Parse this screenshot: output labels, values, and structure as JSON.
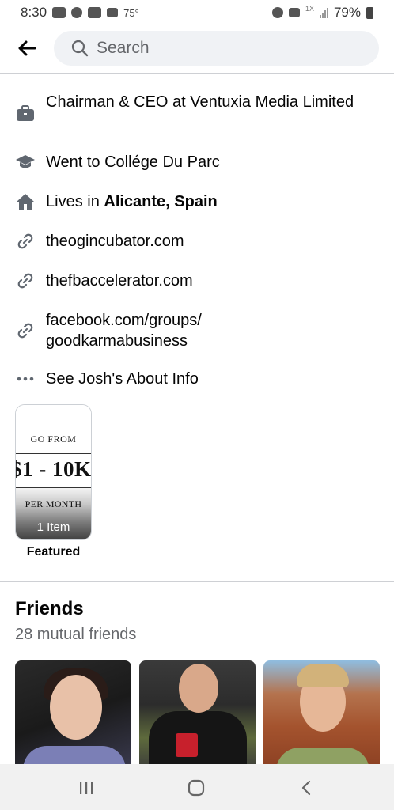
{
  "status_bar": {
    "time": "8:30",
    "temperature": "75°",
    "battery": "79%",
    "network": "1X"
  },
  "search": {
    "placeholder": "Search"
  },
  "intro": {
    "work": "Chairman & CEO at Ventuxia Media Limited",
    "education": "Went to Collége Du Parc",
    "lives_prefix": "Lives in",
    "lives_city": "Alicante, Spain",
    "link1": "theogincubator.com",
    "link2": "thefbaccelerator.com",
    "link3_line1": "facebook.com/groups/",
    "link3_line2": "goodkarmabusiness",
    "about": "See Josh's About Info"
  },
  "featured": {
    "card_top": "GO FROM",
    "card_amount": "$1 - 10K",
    "card_bottom": "PER MONTH",
    "count": "1 Item",
    "label": "Featured"
  },
  "friends": {
    "title": "Friends",
    "subtitle": "28 mutual friends"
  },
  "icons": {
    "back": "arrow-left-icon",
    "search": "search-icon",
    "work": "briefcase-icon",
    "education": "graduation-cap-icon",
    "home": "home-icon",
    "link": "link-icon",
    "more": "more-dots-icon"
  },
  "colors": {
    "icon_gray": "#606770",
    "muted_text": "#65676b",
    "search_bg": "#f0f2f5"
  }
}
